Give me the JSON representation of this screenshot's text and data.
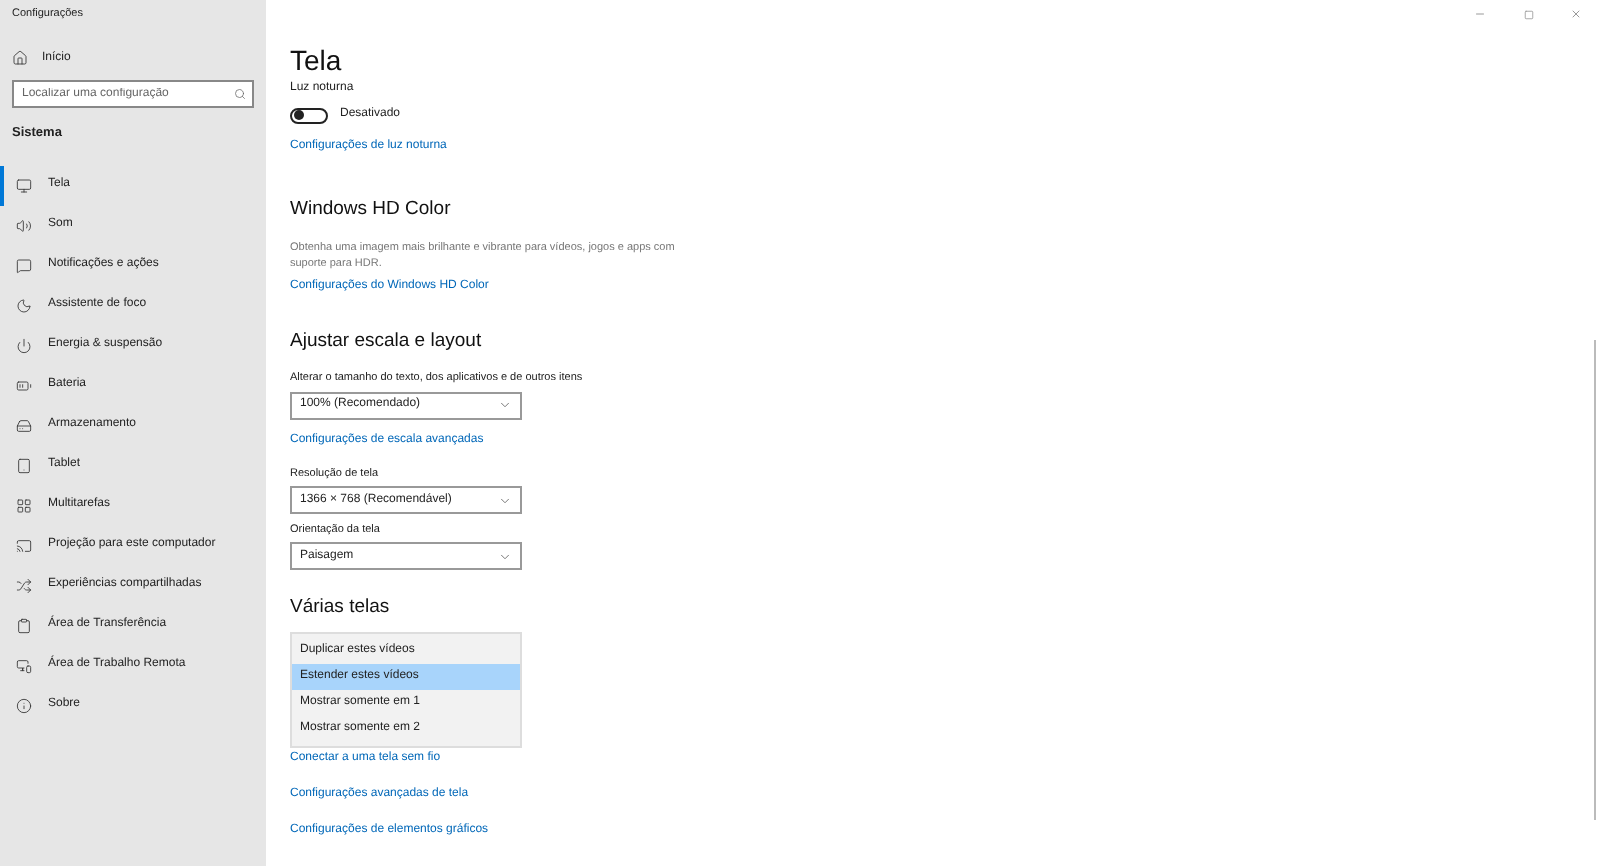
{
  "window": {
    "title": "Configurações"
  },
  "sidebar": {
    "home": "Início",
    "search": {
      "placeholder": "Localizar uma configuração"
    },
    "section": "Sistema",
    "items": [
      {
        "label": "Tela",
        "selected": true
      },
      {
        "label": "Som",
        "selected": false
      },
      {
        "label": "Notificações e ações",
        "selected": false
      },
      {
        "label": "Assistente de foco",
        "selected": false
      },
      {
        "label": "Energia & suspensão",
        "selected": false
      },
      {
        "label": "Bateria",
        "selected": false
      },
      {
        "label": "Armazenamento",
        "selected": false
      },
      {
        "label": "Tablet",
        "selected": false
      },
      {
        "label": "Multitarefas",
        "selected": false
      },
      {
        "label": "Projeção para este computador",
        "selected": false
      },
      {
        "label": "Experiências compartilhadas",
        "selected": false
      },
      {
        "label": "Área de Transferência",
        "selected": false
      },
      {
        "label": "Área de Trabalho Remota",
        "selected": false
      },
      {
        "label": "Sobre",
        "selected": false
      }
    ]
  },
  "page": {
    "title": "Tela",
    "night_light": {
      "label": "Luz noturna",
      "on": false,
      "state": "Desativado",
      "link": "Configurações de luz noturna"
    },
    "hd_color": {
      "heading": "Windows HD Color",
      "description": "Obtenha uma imagem mais brilhante e vibrante para vídeos, jogos e apps com suporte para HDR.",
      "link": "Configurações do Windows HD Color"
    },
    "scale": {
      "heading": "Ajustar escala e layout",
      "size_label": "Alterar o tamanho do texto, dos aplicativos e de outros itens",
      "size_value": "100% (Recomendado)",
      "scale_link": "Configurações de escala avançadas",
      "resolution_label": "Resolução de tela",
      "resolution_value": "1366 × 768 (Recomendável)",
      "orientation_label": "Orientação da tela",
      "orientation_value": "Paisagem"
    },
    "multiple": {
      "heading": "Várias telas",
      "options": [
        {
          "label": "Duplicar estes vídeos",
          "selected": false
        },
        {
          "label": "Estender estes vídeos",
          "selected": true
        },
        {
          "label": "Mostrar somente em 1",
          "selected": false
        },
        {
          "label": "Mostrar somente em 2",
          "selected": false
        }
      ],
      "links": [
        "Conectar a uma tela sem fio",
        "Configurações avançadas de tela",
        "Configurações de elementos gráficos"
      ]
    }
  }
}
